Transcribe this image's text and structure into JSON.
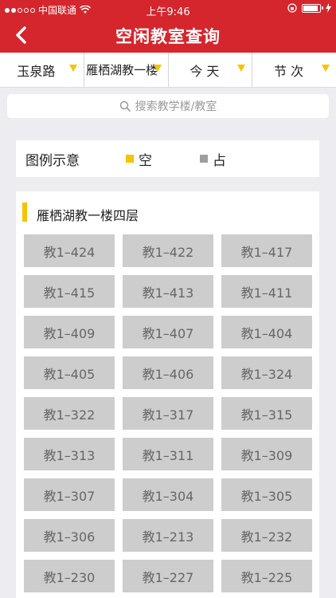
{
  "status": {
    "carrier": "中国联通",
    "time": "上午9:46"
  },
  "nav": {
    "title": "空闲教室查询"
  },
  "filters": [
    {
      "label": "玉泉路"
    },
    {
      "label": "雁栖湖教一楼"
    },
    {
      "label": "今 天"
    },
    {
      "label": "节 次"
    }
  ],
  "search": {
    "placeholder": "搜索教学楼/教室"
  },
  "legend": {
    "title": "图例示意",
    "free_label": "空",
    "occupied_label": "占",
    "free_color": "#f5c400",
    "occupied_color": "#9e9e9e"
  },
  "panel": {
    "floor_title": "雁栖湖教一楼四层",
    "rooms": [
      "教1–424",
      "教1–422",
      "教1–417",
      "教1–415",
      "教1–413",
      "教1–411",
      "教1–409",
      "教1–407",
      "教1–404",
      "教1–405",
      "教1–406",
      "教1–324",
      "教1–322",
      "教1–317",
      "教1–315",
      "教1–313",
      "教1–311",
      "教1–309",
      "教1–307",
      "教1–304",
      "教1–305",
      "教1–306",
      "教1–213",
      "教1–232",
      "教1–230",
      "教1–227",
      "教1–225"
    ]
  }
}
